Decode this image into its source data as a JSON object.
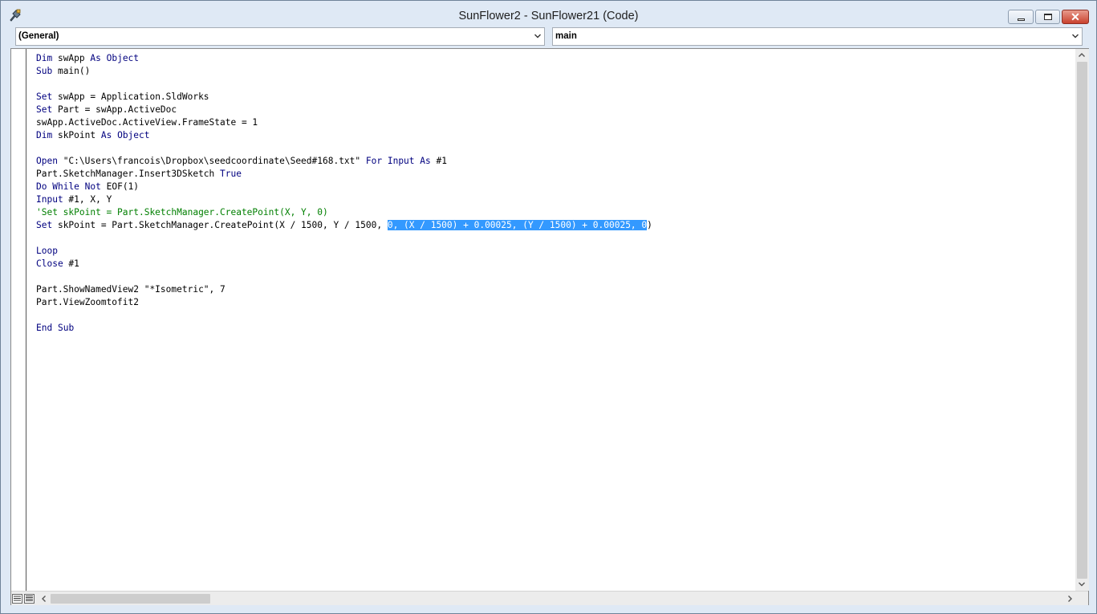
{
  "window": {
    "title": "SunFlower2 - SunFlower21 (Code)"
  },
  "object_combo": {
    "value": "(General)"
  },
  "procedure_combo": {
    "value": "main"
  },
  "code": {
    "lines": [
      {
        "parts": [
          {
            "t": "Dim",
            "c": "kw"
          },
          {
            "t": " swApp ",
            "c": ""
          },
          {
            "t": "As",
            "c": "kw"
          },
          {
            "t": " ",
            "c": ""
          },
          {
            "t": "Object",
            "c": "kw"
          }
        ]
      },
      {
        "parts": [
          {
            "t": "Sub",
            "c": "kw"
          },
          {
            "t": " main()",
            "c": ""
          }
        ]
      },
      {
        "parts": []
      },
      {
        "parts": [
          {
            "t": "Set",
            "c": "kw"
          },
          {
            "t": " swApp = Application.SldWorks",
            "c": ""
          }
        ]
      },
      {
        "parts": [
          {
            "t": "Set",
            "c": "kw"
          },
          {
            "t": " Part = swApp.ActiveDoc",
            "c": ""
          }
        ]
      },
      {
        "parts": [
          {
            "t": "swApp.ActiveDoc.ActiveView.FrameState = 1",
            "c": ""
          }
        ]
      },
      {
        "parts": [
          {
            "t": "Dim",
            "c": "kw"
          },
          {
            "t": " skPoint ",
            "c": ""
          },
          {
            "t": "As",
            "c": "kw"
          },
          {
            "t": " ",
            "c": ""
          },
          {
            "t": "Object",
            "c": "kw"
          }
        ]
      },
      {
        "parts": []
      },
      {
        "parts": [
          {
            "t": "Open",
            "c": "kw"
          },
          {
            "t": " \"C:\\Users\\francois\\Dropbox\\seedcoordinate\\Seed#168.txt\" ",
            "c": ""
          },
          {
            "t": "For",
            "c": "kw"
          },
          {
            "t": " ",
            "c": ""
          },
          {
            "t": "Input",
            "c": "kw"
          },
          {
            "t": " ",
            "c": ""
          },
          {
            "t": "As",
            "c": "kw"
          },
          {
            "t": " #1",
            "c": ""
          }
        ]
      },
      {
        "parts": [
          {
            "t": "Part.SketchManager.Insert3DSketch ",
            "c": ""
          },
          {
            "t": "True",
            "c": "kw"
          }
        ]
      },
      {
        "parts": [
          {
            "t": "Do",
            "c": "kw"
          },
          {
            "t": " ",
            "c": ""
          },
          {
            "t": "While",
            "c": "kw"
          },
          {
            "t": " ",
            "c": ""
          },
          {
            "t": "Not",
            "c": "kw"
          },
          {
            "t": " EOF(1)",
            "c": ""
          }
        ]
      },
      {
        "parts": [
          {
            "t": "Input",
            "c": "kw"
          },
          {
            "t": " #1, X, Y",
            "c": ""
          }
        ]
      },
      {
        "parts": [
          {
            "t": "'Set skPoint = Part.SketchManager.CreatePoint(X, Y, 0)",
            "c": "cm"
          }
        ]
      },
      {
        "parts": [
          {
            "t": "Set",
            "c": "kw"
          },
          {
            "t": " skPoint = Part.SketchManager.CreatePoint(X / 1500, Y / 1500, ",
            "c": ""
          },
          {
            "t": "0, (X / 1500) + 0.00025, (Y / 1500) + 0.00025, 0",
            "c": "sel"
          },
          {
            "t": ")",
            "c": ""
          }
        ]
      },
      {
        "parts": []
      },
      {
        "parts": [
          {
            "t": "Loop",
            "c": "kw"
          }
        ]
      },
      {
        "parts": [
          {
            "t": "Close",
            "c": "kw"
          },
          {
            "t": " #1",
            "c": ""
          }
        ]
      },
      {
        "parts": []
      },
      {
        "parts": [
          {
            "t": "Part.ShowNamedView2 \"*Isometric\", 7",
            "c": ""
          }
        ]
      },
      {
        "parts": [
          {
            "t": "Part.ViewZoomtofit2",
            "c": ""
          }
        ]
      },
      {
        "parts": []
      },
      {
        "parts": [
          {
            "t": "End",
            "c": "kw"
          },
          {
            "t": " ",
            "c": ""
          },
          {
            "t": "Sub",
            "c": "kw"
          }
        ]
      }
    ]
  },
  "icons": {
    "app": "vba-editor-icon",
    "minimize": "minimize-icon",
    "maximize": "maximize-icon",
    "close": "close-icon"
  },
  "colors": {
    "keyword": "#00007f",
    "comment": "#007f00",
    "selection": "#3399ff",
    "close_button": "#c9422e"
  }
}
